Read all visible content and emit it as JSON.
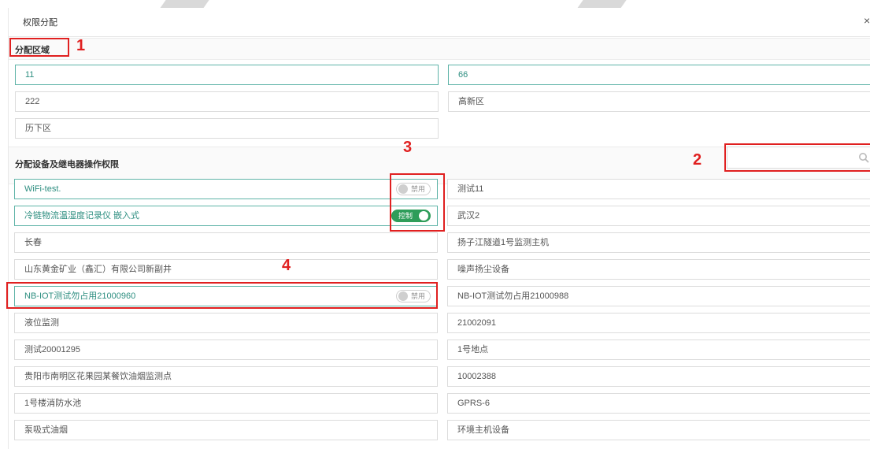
{
  "dialog": {
    "title": "权限分配",
    "close_glyph": "×"
  },
  "region_section": {
    "title": "分配区域",
    "items": [
      "11",
      "66",
      "222",
      "高新区",
      "历下区"
    ]
  },
  "device_section": {
    "title": "分配设备及继电器操作权限",
    "search_placeholder": "",
    "left_items": [
      {
        "label": "WiFi-test.",
        "active": true,
        "toggle": "禁用",
        "toggle_state": "off"
      },
      {
        "label": "冷链物流温湿度记录仪 嵌入式",
        "active": true,
        "toggle": "控制",
        "toggle_state": "on"
      },
      {
        "label": "长春",
        "active": false
      },
      {
        "label": "山东黄金矿业（鑫汇）有限公司新副井",
        "active": false
      },
      {
        "label": "NB-IOT测试勿占用21000960",
        "active": true,
        "toggle": "禁用",
        "toggle_state": "off"
      },
      {
        "label": "液位监测",
        "active": false
      },
      {
        "label": "测试20001295",
        "active": false
      },
      {
        "label": "贵阳市南明区花果园某餐饮油烟监测点",
        "active": false
      },
      {
        "label": "1号楼消防水池",
        "active": false
      },
      {
        "label": "泵吸式油烟",
        "active": false
      }
    ],
    "right_items": [
      "测试11",
      "武汉2",
      "扬子江隧道1号监测主机",
      "噪声扬尘设备",
      "NB-IOT测试勿占用21000988",
      "21002091",
      "1号地点",
      "10002388",
      "GPRS-6",
      "环境主机设备"
    ]
  },
  "callouts": [
    "1",
    "2",
    "3",
    "4"
  ],
  "colors": {
    "accent": "#2d8e80",
    "toggle_on": "#2e9d5a",
    "annotation": "#e02020"
  },
  "icons": {
    "search": "search-icon",
    "close": "close-icon"
  }
}
